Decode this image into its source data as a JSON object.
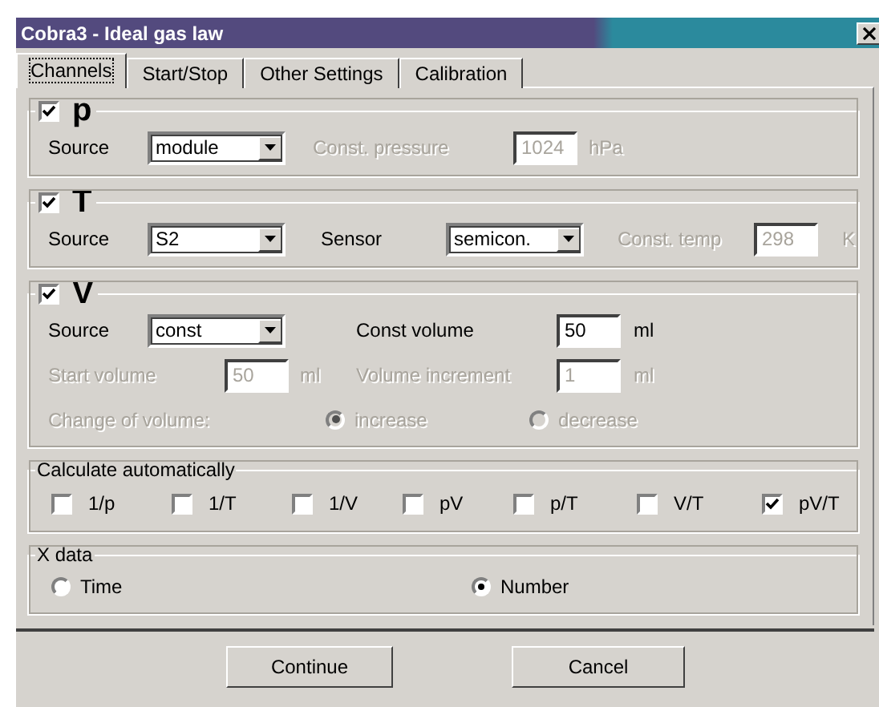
{
  "window": {
    "title": "Cobra3 - Ideal gas law"
  },
  "tabs": [
    {
      "label": "Channels",
      "selected": true
    },
    {
      "label": "Start/Stop",
      "selected": false
    },
    {
      "label": "Other Settings",
      "selected": false
    },
    {
      "label": "Calibration",
      "selected": false
    }
  ],
  "channels": [
    {
      "symbol": "p",
      "checked": true,
      "rows": [
        [
          {
            "kind": "label",
            "text": "Source",
            "disabled": false
          },
          {
            "kind": "select",
            "value": "module",
            "disabled": false
          },
          {
            "kind": "label",
            "text": "Const. pressure",
            "disabled": true
          },
          {
            "kind": "input",
            "value": "1024",
            "disabled": true
          },
          {
            "kind": "label",
            "text": "hPa",
            "disabled": true
          }
        ]
      ]
    },
    {
      "symbol": "T",
      "checked": true,
      "rows": [
        [
          {
            "kind": "label",
            "text": "Source",
            "disabled": false
          },
          {
            "kind": "select",
            "value": "S2",
            "disabled": false
          },
          {
            "kind": "label",
            "text": "Sensor",
            "disabled": false
          },
          {
            "kind": "select",
            "value": "semicon.",
            "disabled": false
          },
          {
            "kind": "label",
            "text": "Const. temp",
            "disabled": true
          },
          {
            "kind": "input",
            "value": "298",
            "disabled": true
          },
          {
            "kind": "label",
            "text": "K",
            "disabled": true
          }
        ]
      ]
    },
    {
      "symbol": "V",
      "checked": true,
      "rows": [
        [
          {
            "kind": "label",
            "text": "Source",
            "disabled": false
          },
          {
            "kind": "select",
            "value": "const",
            "disabled": false
          },
          {
            "kind": "gap"
          },
          {
            "kind": "label",
            "text": "Const volume",
            "disabled": false
          },
          {
            "kind": "input",
            "value": "50",
            "disabled": false
          },
          {
            "kind": "label",
            "text": "ml",
            "disabled": false
          }
        ],
        [
          {
            "kind": "label",
            "text": "Start volume",
            "disabled": true
          },
          {
            "kind": "input",
            "value": "50",
            "disabled": true
          },
          {
            "kind": "label",
            "text": "ml",
            "disabled": true
          },
          {
            "kind": "label",
            "text": "Volume increment",
            "disabled": true
          },
          {
            "kind": "input",
            "value": "1",
            "disabled": true
          },
          {
            "kind": "label",
            "text": "ml",
            "disabled": true
          }
        ]
      ],
      "volume_change": {
        "label": "Change of volume:",
        "disabled": true,
        "options": [
          {
            "label": "increase",
            "selected": true,
            "disabled": true
          },
          {
            "label": "decrease",
            "selected": false,
            "disabled": true
          }
        ]
      }
    }
  ],
  "calculate": {
    "title": "Calculate automatically",
    "options": [
      {
        "label": "1/p",
        "checked": false
      },
      {
        "label": "1/T",
        "checked": false
      },
      {
        "label": "1/V",
        "checked": false
      },
      {
        "label": "pV",
        "checked": false
      },
      {
        "label": "p/T",
        "checked": false
      },
      {
        "label": "V/T",
        "checked": false
      },
      {
        "label": "pV/T",
        "checked": true
      }
    ]
  },
  "x_data": {
    "title": "X data",
    "options": [
      {
        "label": "Time",
        "selected": false
      },
      {
        "label": "Number",
        "selected": true
      }
    ]
  },
  "buttons": [
    {
      "label": "Continue"
    },
    {
      "label": "Cancel"
    }
  ]
}
